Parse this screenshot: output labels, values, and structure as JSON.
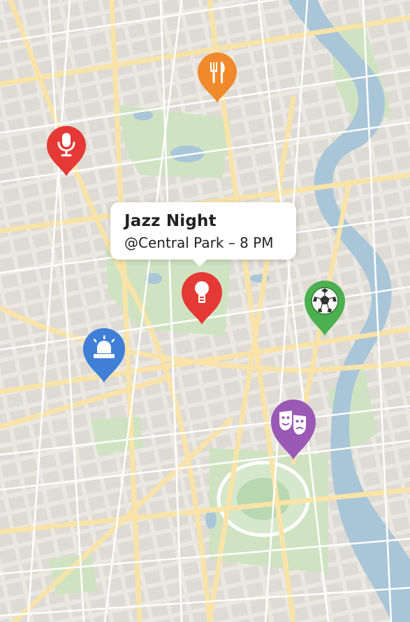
{
  "map": {
    "colors": {
      "land": "#ebe8e2",
      "block": "#dedbd5",
      "road": "#f9e3a8",
      "street": "#ffffff",
      "park": "#cfe3c2",
      "water": "#a9c6d8"
    }
  },
  "callout": {
    "title": "Jazz Night",
    "subtitle": "@Central Park – 8 PM"
  },
  "pins": [
    {
      "id": "restaurant",
      "icon": "fork-knife-icon",
      "color": "#f08a2c"
    },
    {
      "id": "podcast",
      "icon": "microphone-icon",
      "color": "#e53935"
    },
    {
      "id": "jazz-night",
      "icon": "lightbulb-icon",
      "color": "#e53935",
      "selected": true
    },
    {
      "id": "soccer",
      "icon": "soccer-ball-icon",
      "color": "#4caf50"
    },
    {
      "id": "police",
      "icon": "siren-icon",
      "color": "#3f7fd6"
    },
    {
      "id": "theater",
      "icon": "theater-masks-icon",
      "color": "#9b59b6"
    }
  ]
}
